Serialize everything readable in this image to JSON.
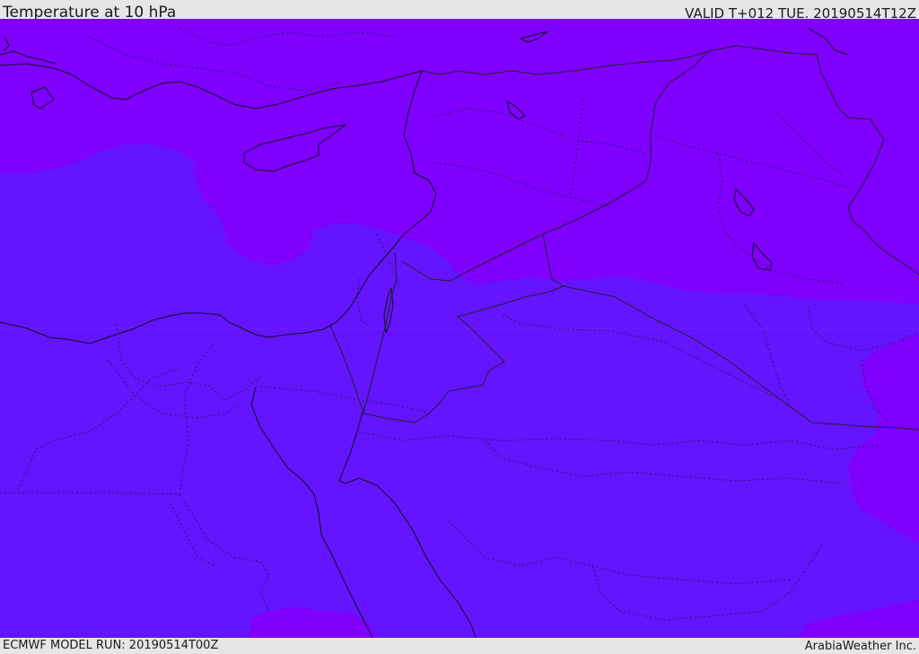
{
  "header": {
    "title": "Temperature at 10 hPa",
    "valid": "VALID T+012 TUE. 20190514T12Z"
  },
  "footer": {
    "model_run": "ECMWF MODEL RUN: 20190514T00Z",
    "credit": "ArabiaWeather Inc."
  },
  "map": {
    "region": "Eastern Mediterranean and Middle East",
    "fill_colors": {
      "warmer": "#7f00ff",
      "cooler": "#6414ff"
    },
    "line_colors": {
      "coastline": "#111111",
      "border": "#222222"
    }
  }
}
